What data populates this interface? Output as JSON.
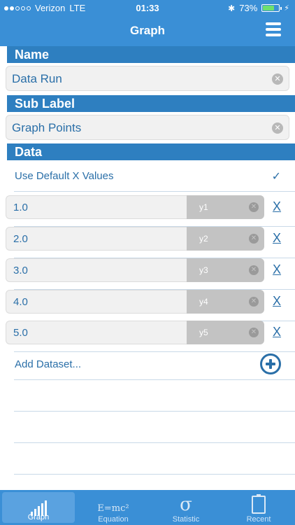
{
  "status_bar": {
    "carrier": "Verizon",
    "network": "LTE",
    "time": "01:33",
    "battery_percent": "73%",
    "battery_level": 0.73
  },
  "nav": {
    "title": "Graph",
    "menu_icon": "hamburger-menu-icon"
  },
  "name_section": {
    "header": "Name",
    "value": "Data Run"
  },
  "sublabel_section": {
    "header": "Sub Label",
    "value": "Graph Points"
  },
  "data_section": {
    "header": "Data",
    "default_x_label": "Use Default X Values",
    "default_x_checked": true,
    "rows": [
      {
        "x": "1.0",
        "y_placeholder": "y1",
        "remove": "X"
      },
      {
        "x": "2.0",
        "y_placeholder": "y2",
        "remove": "X"
      },
      {
        "x": "3.0",
        "y_placeholder": "y3",
        "remove": "X"
      },
      {
        "x": "4.0",
        "y_placeholder": "y4",
        "remove": "X"
      },
      {
        "x": "5.0",
        "y_placeholder": "y5",
        "remove": "X"
      }
    ],
    "add_label": "Add Dataset..."
  },
  "tabbar": {
    "tabs": [
      {
        "label": "Graph",
        "icon": "bar-graph-icon",
        "active": true
      },
      {
        "label": "Equation",
        "icon": "emc2-icon",
        "icon_text": "E=mc²"
      },
      {
        "label": "Statistic",
        "icon": "sigma-icon",
        "icon_text": "σ"
      },
      {
        "label": "Recent",
        "icon": "clipboard-icon"
      }
    ]
  },
  "colors": {
    "primary": "#3a8fd6",
    "section": "#2e7fc0",
    "text": "#2a6fa8"
  }
}
